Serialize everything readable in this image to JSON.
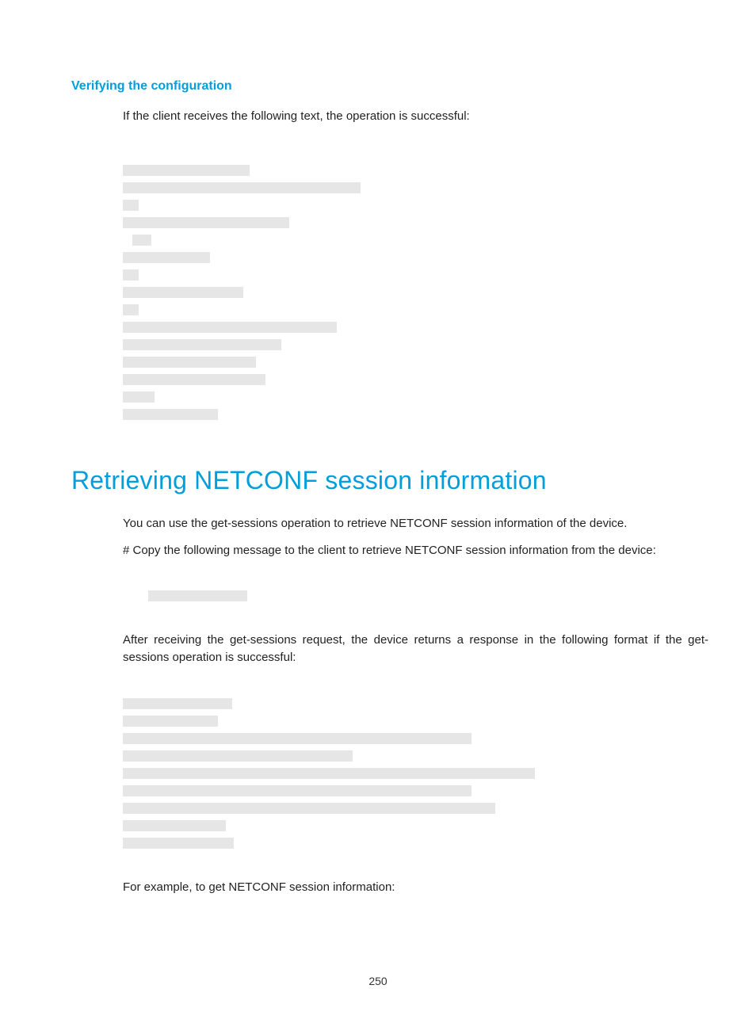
{
  "heading3": "Verifying the configuration",
  "para1": "If the client receives the following text, the operation is successful:",
  "codeblock1_widths": [
    160,
    300,
    20,
    210,
    24,
    110,
    20,
    152,
    20,
    270,
    200,
    168,
    180,
    40,
    120
  ],
  "codeblock1_indents": [
    0,
    0,
    0,
    0,
    12,
    0,
    0,
    0,
    0,
    0,
    0,
    0,
    0,
    0,
    0
  ],
  "heading1": "Retrieving NETCONF session information",
  "para2": "You can use the get-sessions operation to retrieve NETCONF session information of the device.",
  "para3": "# Copy the following message to the client to retrieve NETCONF session information from the device:",
  "codeblock2_widths": [
    125
  ],
  "codeblock2_indents": [
    32
  ],
  "para4": "After receiving the get-sessions request, the device returns a response in the following format if the get-sessions operation is successful:",
  "codeblock3_widths": [
    138,
    120,
    440,
    290,
    520,
    440,
    470,
    130,
    140
  ],
  "codeblock3_indents": [
    0,
    0,
    0,
    0,
    0,
    0,
    0,
    0,
    0
  ],
  "para5": "For example, to get NETCONF session information:",
  "pageNumber": "250"
}
